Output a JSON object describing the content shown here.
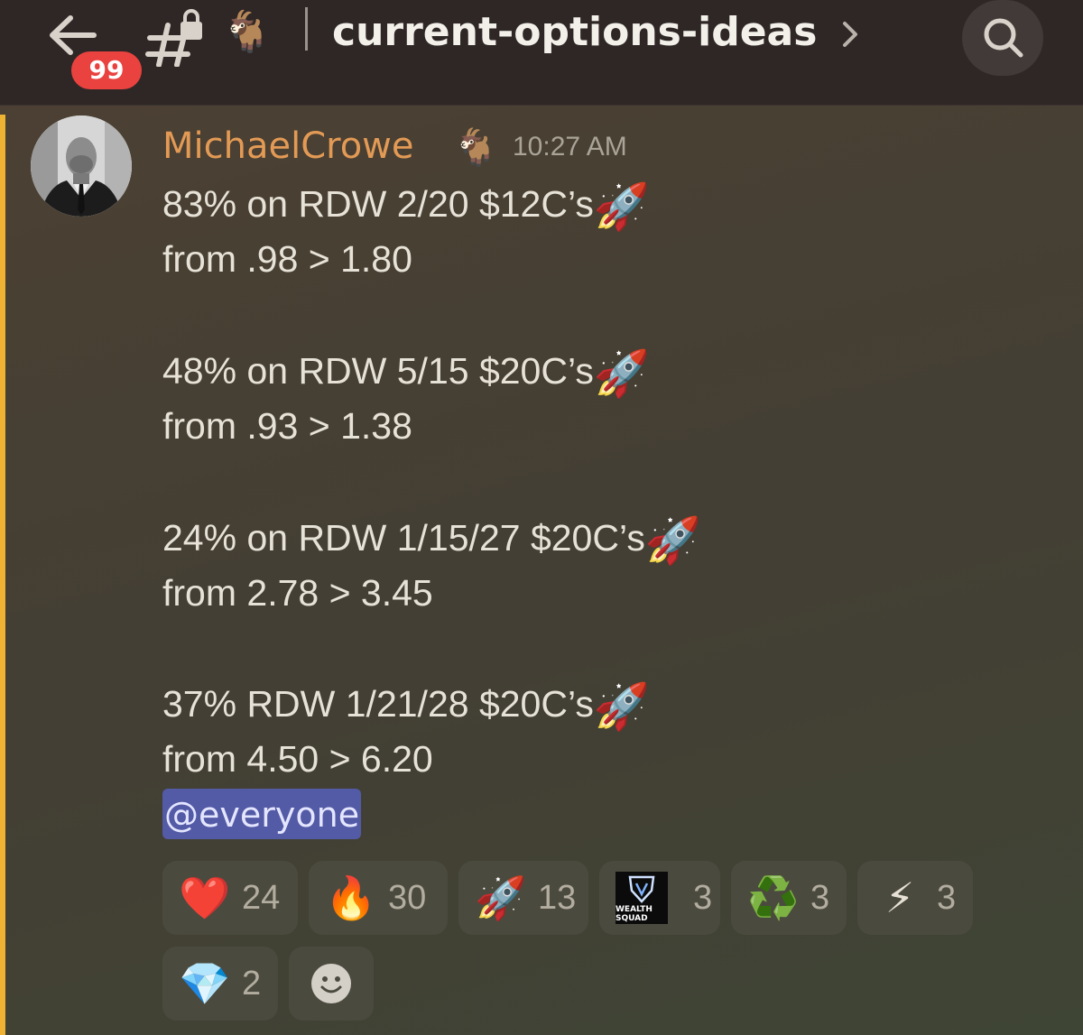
{
  "header": {
    "unread_count": "99",
    "channel_name": "current-options-ideas",
    "channel_emoji": "🐐"
  },
  "message": {
    "author": "MichaelCrowe",
    "author_emoji": "🐐",
    "timestamp": "10:27 AM",
    "lines": [
      {
        "text": "83% on RDW 2/20 $12C’s",
        "emoji": "🚀"
      },
      {
        "text": "from .98 > 1.80",
        "emoji": ""
      },
      {
        "text": "48% on RDW 5/15 $20C’s",
        "emoji": "🚀"
      },
      {
        "text": "from .93 > 1.38",
        "emoji": ""
      },
      {
        "text": "24% on RDW 1/15/27 $20C’s",
        "emoji": "🚀"
      },
      {
        "text": "from 2.78 > 3.45",
        "emoji": ""
      },
      {
        "text": "37% RDW 1/21/28 $20C’s",
        "emoji": "🚀"
      },
      {
        "text": "from 4.50 > 6.20",
        "emoji": ""
      }
    ],
    "mention": "@everyone"
  },
  "reactions": [
    {
      "emoji": "❤️",
      "icon": "heart-icon",
      "count": "24"
    },
    {
      "emoji": "🔥",
      "icon": "fire-icon",
      "count": "30"
    },
    {
      "emoji": "🚀",
      "icon": "rocket-icon",
      "count": "13"
    },
    {
      "emoji": "",
      "icon": "wealth-squad-logo-icon",
      "logo_text": "WEALTH SQUAD",
      "count": "3"
    },
    {
      "emoji": "♻️",
      "icon": "recycle-icon",
      "count": "3"
    },
    {
      "emoji": "⚡",
      "icon": "lightning-icon",
      "count": "3"
    },
    {
      "emoji": "💎",
      "icon": "diamond-icon",
      "count": "2"
    }
  ],
  "colors": {
    "accent_mention_bar": "#f0b232",
    "username": "#e39a55",
    "badge": "#e9423f",
    "mention_bg": "#535aa6"
  }
}
